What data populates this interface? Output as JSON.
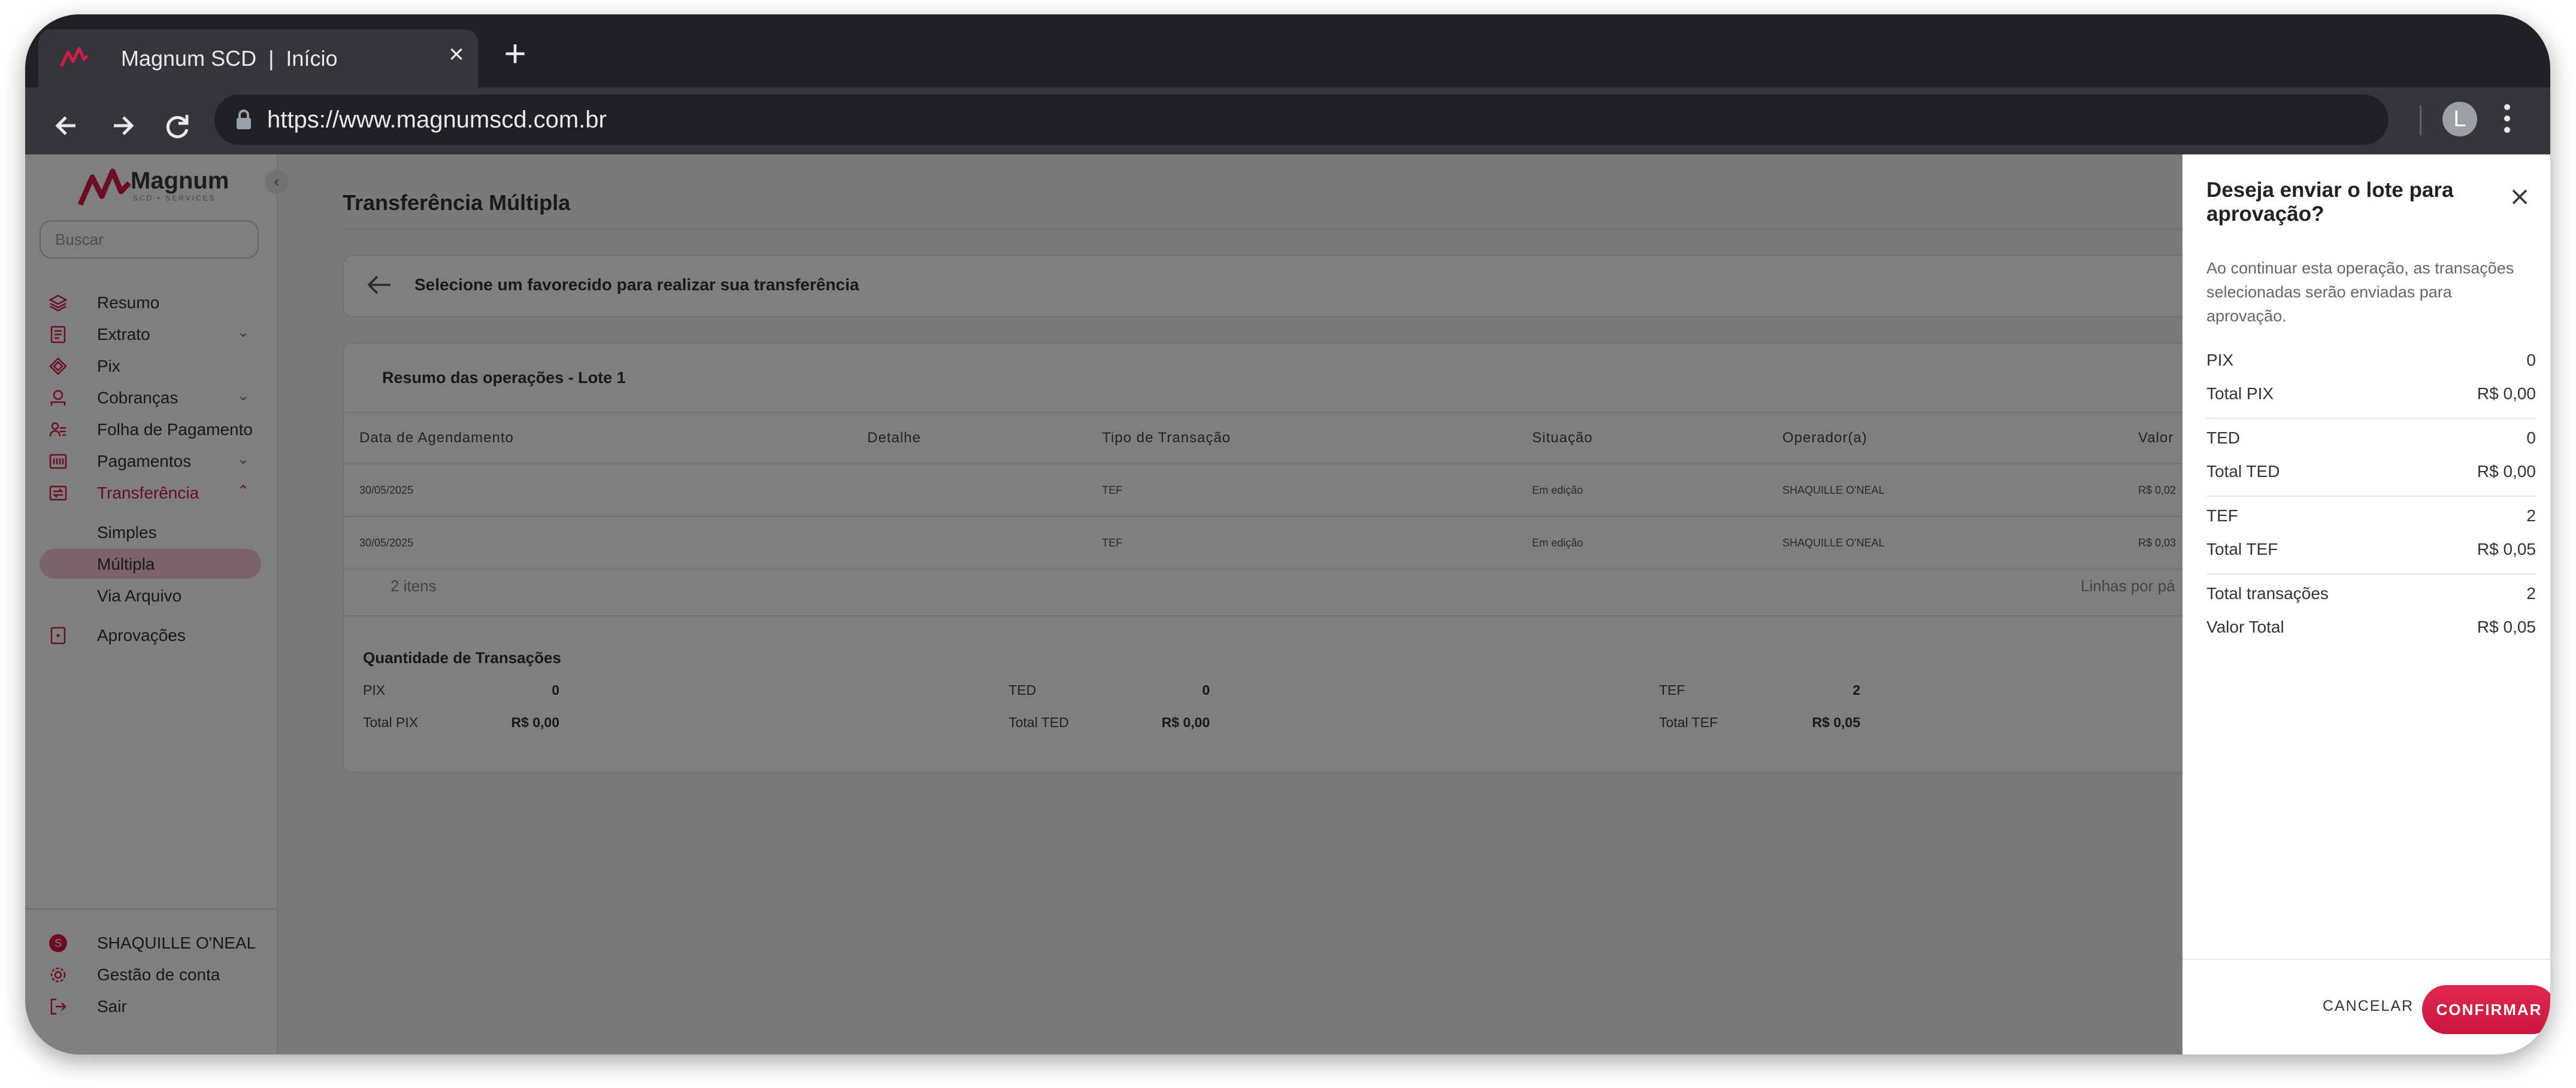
{
  "browser": {
    "tab_title": "Magnum SCD  |  Início",
    "url": "https://www.magnumscd.com.br",
    "profile_initial": "L"
  },
  "brand": {
    "name": "Magnum",
    "sub": "SCD • SERVICES",
    "accent": "#d81b46"
  },
  "sidebar": {
    "search_placeholder": "Buscar",
    "items": [
      {
        "label": "Resumo",
        "icon": "layers-icon"
      },
      {
        "label": "Extrato",
        "icon": "document-icon"
      },
      {
        "label": "Pix",
        "icon": "pix-icon"
      },
      {
        "label": "Cobranças",
        "icon": "billing-icon"
      },
      {
        "label": "Folha de Pagamento",
        "icon": "payroll-icon"
      },
      {
        "label": "Pagamentos",
        "icon": "payments-icon"
      },
      {
        "label": "Transferência",
        "icon": "transfer-icon"
      }
    ],
    "sub_items": [
      {
        "label": "Simples"
      },
      {
        "label": "Múltipla"
      },
      {
        "label": "Via Arquivo"
      }
    ],
    "approvals": {
      "label": "Aprovações",
      "icon": "approval-icon"
    },
    "user": {
      "initial": "S",
      "name": "SHAQUILLE O'NEAL"
    },
    "account": {
      "label": "Gestão de conta"
    },
    "logout": {
      "label": "Sair"
    }
  },
  "main": {
    "title": "Transferência Múltipla",
    "select_message": "Selecione um favorecido para realizar sua transferência",
    "lote_title": "Resumo das operações - Lote 1",
    "columns": [
      "Data de Agendamento",
      "Detalhe",
      "Tipo de Transação",
      "Situação",
      "Operador(a)",
      "Valor"
    ],
    "rows": [
      [
        "30/05/2025",
        "",
        "TEF",
        "Em edição",
        "SHAQUILLE O'NEAL",
        "R$ 0,02"
      ],
      [
        "30/05/2025",
        "",
        "TEF",
        "Em edição",
        "SHAQUILLE O'NEAL",
        "R$ 0,03"
      ]
    ],
    "items_count": "2 itens",
    "rows_per_page": "Linhas por pá",
    "quantity": {
      "title": "Quantidade de Transações",
      "pix_label": "PIX",
      "pix_count": "0",
      "total_pix_label": "Total PIX",
      "total_pix": "R$ 0,00",
      "ted_label": "TED",
      "ted_count": "0",
      "total_ted_label": "Total TED",
      "total_ted": "R$ 0,00",
      "tef_label": "TEF",
      "tef_count": "2",
      "total_tef_label": "Total TEF",
      "total_tef": "R$ 0,05"
    }
  },
  "drawer": {
    "title": "Deseja enviar o lote para aprovação?",
    "description": "Ao continuar esta operação, as transações selecionadas serão enviadas para aprovação.",
    "rows": [
      {
        "label": "PIX",
        "value": "0"
      },
      {
        "label": "Total PIX",
        "value": "R$ 0,00"
      },
      {
        "label": "TED",
        "value": "0"
      },
      {
        "label": "Total TED",
        "value": "R$ 0,00"
      },
      {
        "label": "TEF",
        "value": "2"
      },
      {
        "label": "Total TEF",
        "value": "R$ 0,05"
      },
      {
        "label": "Total transações",
        "value": "2"
      },
      {
        "label": "Valor Total",
        "value": "R$ 0,05"
      }
    ],
    "cancel_label": "CANCELAR",
    "confirm_label": "CONFIRMAR"
  }
}
